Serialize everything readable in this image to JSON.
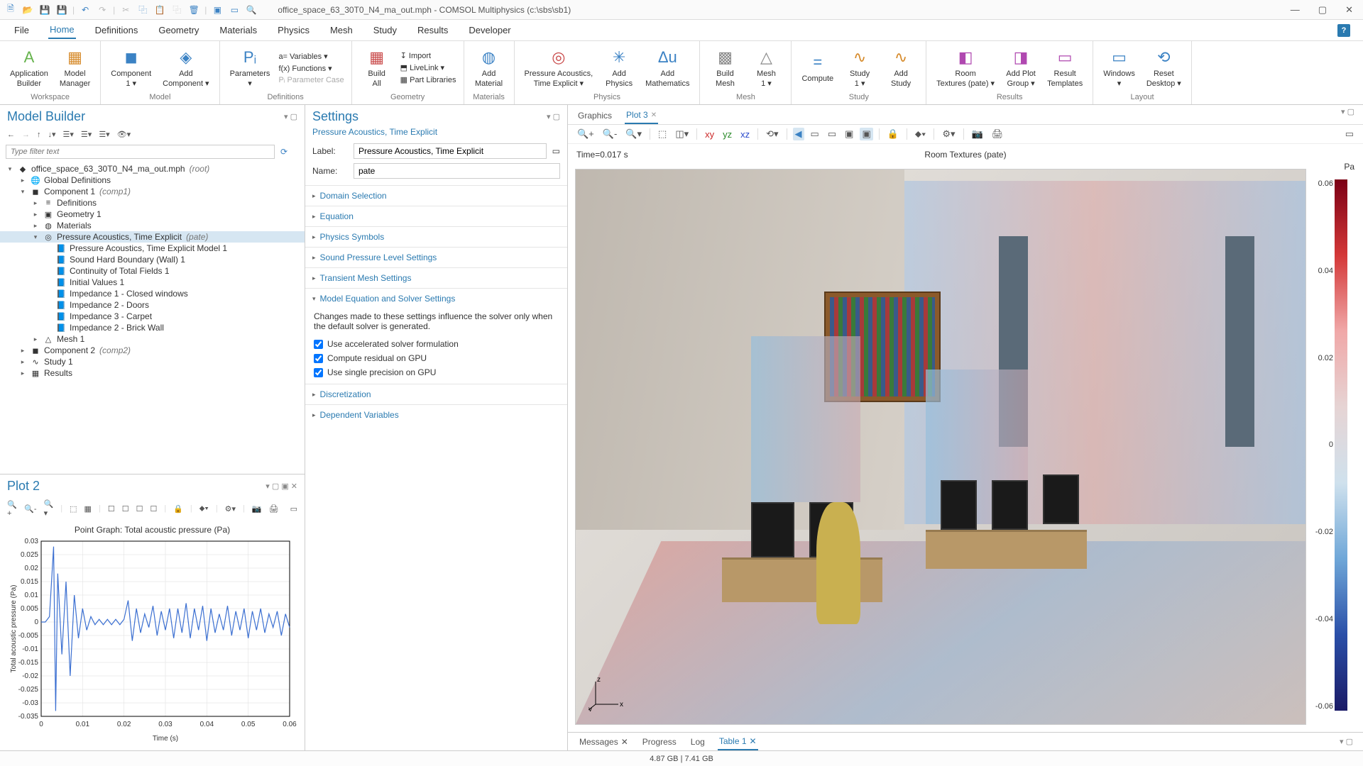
{
  "titlebar": {
    "filename": "office_space_63_30T0_N4_ma_out.mph",
    "app": "COMSOL Multiphysics",
    "path": "c:\\sbs\\sb1"
  },
  "menubar": {
    "items": [
      "File",
      "Home",
      "Definitions",
      "Geometry",
      "Materials",
      "Physics",
      "Mesh",
      "Study",
      "Results",
      "Developer"
    ],
    "active": "Home"
  },
  "ribbon": {
    "groups": [
      {
        "name": "Workspace",
        "buttons": [
          {
            "label": "Application\nBuilder",
            "icon": "A",
            "color": "#66b34d"
          },
          {
            "label": "Model\nManager",
            "icon": "▦",
            "color": "#d68a2a"
          }
        ]
      },
      {
        "name": "Model",
        "buttons": [
          {
            "label": "Component\n1 ▾",
            "icon": "◼",
            "color": "#3b82c4"
          },
          {
            "label": "Add\nComponent ▾",
            "icon": "◈",
            "color": "#3b82c4"
          }
        ]
      },
      {
        "name": "Definitions",
        "main": {
          "label": "Parameters\n▾",
          "icon": "Pᵢ",
          "color": "#3b82c4"
        },
        "small": [
          "a= Variables ▾",
          "f(x) Functions ▾",
          "Pᵢ Parameter Case"
        ]
      },
      {
        "name": "Geometry",
        "main": {
          "label": "Build\nAll",
          "icon": "▦",
          "color": "#c94a4a"
        },
        "small": [
          "↧ Import",
          "⬒ LiveLink ▾",
          "▦ Part Libraries"
        ]
      },
      {
        "name": "Materials",
        "buttons": [
          {
            "label": "Add\nMaterial",
            "icon": "◍",
            "color": "#3b82c4"
          }
        ]
      },
      {
        "name": "Physics",
        "buttons": [
          {
            "label": "Pressure Acoustics,\nTime Explicit ▾",
            "icon": "◎",
            "color": "#c94a4a"
          },
          {
            "label": "Add\nPhysics",
            "icon": "✳",
            "color": "#3b82c4"
          },
          {
            "label": "Add\nMathematics",
            "icon": "Δu",
            "color": "#3b82c4"
          }
        ]
      },
      {
        "name": "Mesh",
        "buttons": [
          {
            "label": "Build\nMesh",
            "icon": "▩",
            "color": "#888"
          },
          {
            "label": "Mesh\n1 ▾",
            "icon": "△",
            "color": "#888"
          }
        ]
      },
      {
        "name": "Study",
        "buttons": [
          {
            "label": "Compute",
            "icon": "=",
            "color": "#3b82c4"
          },
          {
            "label": "Study\n1 ▾",
            "icon": "∿",
            "color": "#d68a2a"
          },
          {
            "label": "Add\nStudy",
            "icon": "∿",
            "color": "#d68a2a"
          }
        ]
      },
      {
        "name": "Results",
        "buttons": [
          {
            "label": "Room\nTextures (pate) ▾",
            "icon": "◧",
            "color": "#b048b0"
          },
          {
            "label": "Add Plot\nGroup ▾",
            "icon": "◨",
            "color": "#b048b0"
          },
          {
            "label": "Result\nTemplates",
            "icon": "▭",
            "color": "#b048b0"
          }
        ]
      },
      {
        "name": "Layout",
        "buttons": [
          {
            "label": "Windows\n▾",
            "icon": "▭",
            "color": "#3b82c4"
          },
          {
            "label": "Reset\nDesktop ▾",
            "icon": "⟲",
            "color": "#3b82c4"
          }
        ]
      }
    ]
  },
  "model_builder": {
    "title": "Model Builder",
    "filter_placeholder": "Type filter text",
    "root": {
      "label": "office_space_63_30T0_N4_ma_out.mph",
      "ann": "(root)"
    },
    "tree": [
      {
        "indent": 1,
        "caret": "▸",
        "ico": "🌐",
        "label": "Global Definitions"
      },
      {
        "indent": 1,
        "caret": "▾",
        "ico": "◼",
        "label": "Component 1",
        "ann": "(comp1)"
      },
      {
        "indent": 2,
        "caret": "▸",
        "ico": "≡",
        "label": "Definitions"
      },
      {
        "indent": 2,
        "caret": "▸",
        "ico": "▣",
        "label": "Geometry 1"
      },
      {
        "indent": 2,
        "caret": "▸",
        "ico": "◍",
        "label": "Materials"
      },
      {
        "indent": 2,
        "caret": "▾",
        "ico": "◎",
        "label": "Pressure Acoustics, Time Explicit",
        "ann": "(pate)",
        "selected": true
      },
      {
        "indent": 3,
        "caret": "",
        "ico": "📘",
        "label": "Pressure Acoustics, Time Explicit Model 1"
      },
      {
        "indent": 3,
        "caret": "",
        "ico": "📘",
        "label": "Sound Hard Boundary (Wall) 1"
      },
      {
        "indent": 3,
        "caret": "",
        "ico": "📘",
        "label": "Continuity of Total Fields 1"
      },
      {
        "indent": 3,
        "caret": "",
        "ico": "📘",
        "label": "Initial Values 1"
      },
      {
        "indent": 3,
        "caret": "",
        "ico": "📘",
        "label": "Impedance 1 - Closed windows"
      },
      {
        "indent": 3,
        "caret": "",
        "ico": "📘",
        "label": "Impedance 2 - Doors"
      },
      {
        "indent": 3,
        "caret": "",
        "ico": "📘",
        "label": "Impedance 3 - Carpet"
      },
      {
        "indent": 3,
        "caret": "",
        "ico": "📘",
        "label": "Impedance 2 - Brick Wall"
      },
      {
        "indent": 2,
        "caret": "▸",
        "ico": "△",
        "label": "Mesh 1"
      },
      {
        "indent": 1,
        "caret": "▸",
        "ico": "◼",
        "label": "Component 2",
        "ann": "(comp2)"
      },
      {
        "indent": 1,
        "caret": "▸",
        "ico": "∿",
        "label": "Study 1"
      },
      {
        "indent": 1,
        "caret": "▸",
        "ico": "▦",
        "label": "Results"
      }
    ]
  },
  "settings": {
    "title": "Settings",
    "subtitle": "Pressure Acoustics, Time Explicit",
    "label_label": "Label:",
    "label_value": "Pressure Acoustics, Time Explicit",
    "name_label": "Name:",
    "name_value": "pate",
    "sections": [
      "Domain Selection",
      "Equation",
      "Physics Symbols",
      "Sound Pressure Level Settings",
      "Transient Mesh Settings"
    ],
    "open_section": "Model Equation and Solver Settings",
    "open_body": "Changes made to these settings influence the solver only when the default solver is generated.",
    "checks": [
      {
        "label": "Use accelerated solver formulation",
        "checked": true
      },
      {
        "label": "Compute residual on GPU",
        "checked": true
      },
      {
        "label": "Use single precision on GPU",
        "checked": true
      }
    ],
    "sections2": [
      "Discretization",
      "Dependent Variables"
    ]
  },
  "plot2": {
    "title": "Plot 2",
    "chart_title": "Point Graph: Total acoustic pressure (Pa)",
    "xlabel": "Time (s)",
    "ylabel": "Total acoustic pressure (Pa)"
  },
  "graphics_tabs": {
    "tabs": [
      {
        "label": "Graphics",
        "active": false
      },
      {
        "label": "Plot 3",
        "active": true,
        "closable": true
      }
    ]
  },
  "plot3": {
    "time_label": "Time=0.017 s",
    "title": "Room Textures (pate)",
    "unit": "Pa",
    "ticks": [
      "0.06",
      "0.04",
      "0.02",
      "0",
      "-0.02",
      "-0.04",
      "-0.06"
    ]
  },
  "bottom_tabs": {
    "tabs": [
      {
        "label": "Messages",
        "closable": true
      },
      {
        "label": "Progress"
      },
      {
        "label": "Log"
      },
      {
        "label": "Table 1",
        "active": true,
        "closable": true
      }
    ]
  },
  "status": {
    "mem": "4.87 GB | 7.41 GB"
  },
  "chart_data": {
    "type": "line",
    "title": "Point Graph: Total acoustic pressure (Pa)",
    "xlabel": "Time (s)",
    "ylabel": "Total acoustic pressure (Pa)",
    "xlim": [
      0,
      0.06
    ],
    "ylim": [
      -0.035,
      0.03
    ],
    "xticks": [
      0,
      0.01,
      0.02,
      0.03,
      0.04,
      0.05,
      0.06
    ],
    "yticks": [
      -0.035,
      -0.03,
      -0.025,
      -0.02,
      -0.015,
      -0.01,
      -0.005,
      0,
      0.005,
      0.01,
      0.015,
      0.02,
      0.025,
      0.03
    ],
    "series": [
      {
        "name": "pressure",
        "x": [
          0,
          0.001,
          0.002,
          0.003,
          0.0035,
          0.004,
          0.005,
          0.006,
          0.007,
          0.008,
          0.009,
          0.01,
          0.011,
          0.012,
          0.013,
          0.014,
          0.015,
          0.016,
          0.017,
          0.018,
          0.019,
          0.02,
          0.021,
          0.022,
          0.023,
          0.024,
          0.025,
          0.026,
          0.027,
          0.028,
          0.029,
          0.03,
          0.031,
          0.032,
          0.033,
          0.034,
          0.035,
          0.036,
          0.037,
          0.038,
          0.039,
          0.04,
          0.041,
          0.042,
          0.043,
          0.044,
          0.045,
          0.046,
          0.047,
          0.048,
          0.049,
          0.05,
          0.051,
          0.052,
          0.053,
          0.054,
          0.055,
          0.056,
          0.057,
          0.058,
          0.059,
          0.06
        ],
        "values": [
          0,
          0,
          0.002,
          0.028,
          -0.033,
          0.018,
          -0.012,
          0.015,
          -0.02,
          0.01,
          -0.006,
          0.005,
          -0.003,
          0.002,
          -0.001,
          0.001,
          -0.001,
          0.001,
          -0.001,
          0.001,
          -0.001,
          0.001,
          0.008,
          -0.007,
          0.005,
          -0.004,
          0.003,
          -0.002,
          0.006,
          -0.005,
          0.004,
          -0.003,
          0.005,
          -0.006,
          0.005,
          -0.004,
          0.007,
          -0.006,
          0.005,
          -0.003,
          0.006,
          -0.007,
          0.005,
          -0.004,
          0.003,
          -0.003,
          0.006,
          -0.005,
          0.004,
          -0.003,
          0.005,
          -0.006,
          0.004,
          -0.003,
          0.005,
          -0.004,
          0.003,
          -0.002,
          0.004,
          -0.005,
          0.003,
          -0.002
        ]
      }
    ]
  }
}
